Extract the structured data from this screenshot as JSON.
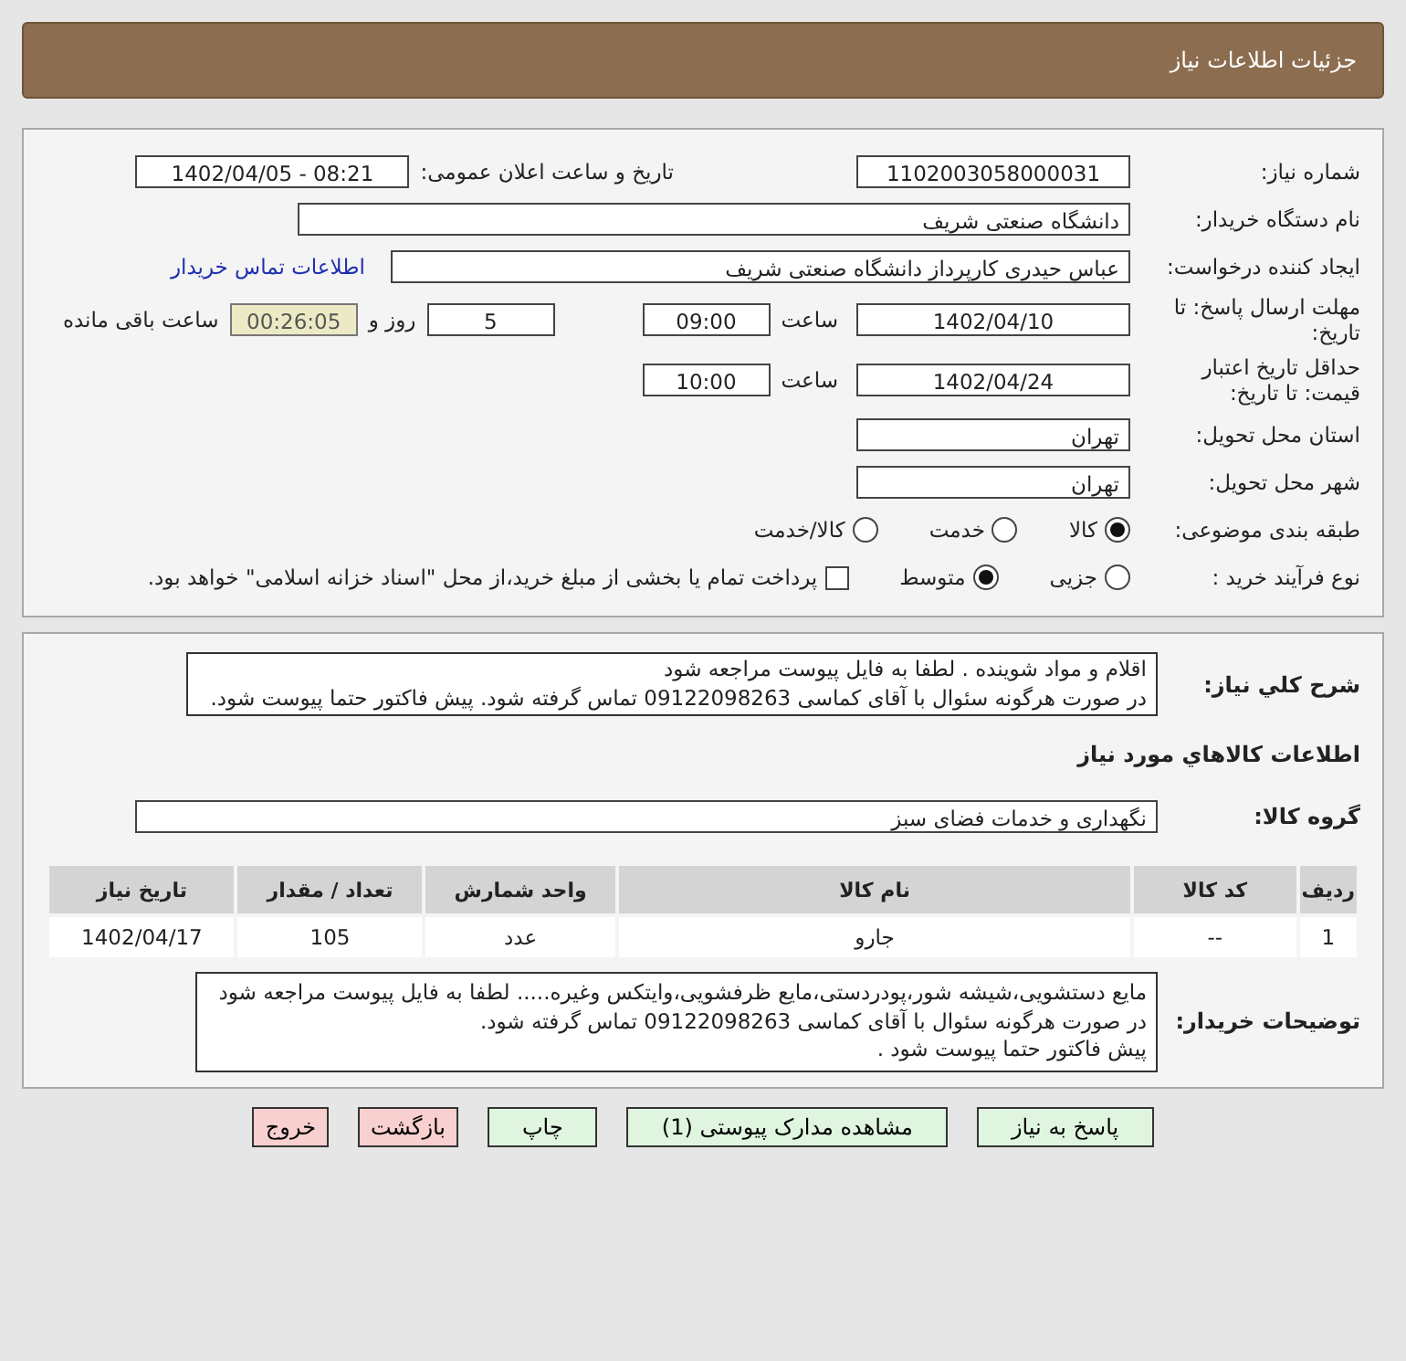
{
  "header": {
    "title": "جزئیات اطلاعات نیاز"
  },
  "need_number": {
    "label": "شماره نیاز:",
    "value": "1102003058000031"
  },
  "announce": {
    "label": "تاریخ و ساعت اعلان عمومی:",
    "value": "1402/04/05 - 08:21"
  },
  "buyer": {
    "label": "نام دستگاه خریدار:",
    "value": "دانشگاه صنعتی شریف"
  },
  "requester": {
    "label": "ایجاد کننده درخواست:",
    "value": "عباس حیدری کارپرداز دانشگاه صنعتی شریف",
    "link": "اطلاعات تماس خریدار"
  },
  "deadline": {
    "label": "مهلت ارسال پاسخ: تا تاریخ:",
    "date": "1402/04/10",
    "time_label": "ساعت",
    "time": "09:00",
    "days": "5",
    "days_label": "روز و",
    "remaining": "00:26:05",
    "remaining_label": "ساعت باقی مانده"
  },
  "validity": {
    "label": "حداقل تاریخ اعتبار قیمت: تا تاریخ:",
    "date": "1402/04/24",
    "time_label": "ساعت",
    "time": "10:00"
  },
  "province": {
    "label": "استان محل تحویل:",
    "value": "تهران"
  },
  "city": {
    "label": "شهر محل تحویل:",
    "value": "تهران"
  },
  "category": {
    "label": "طبقه بندی موضوعی:",
    "options": [
      {
        "label": "کالا",
        "selected": true
      },
      {
        "label": "خدمت",
        "selected": false
      },
      {
        "label": "کالا/خدمت",
        "selected": false
      }
    ]
  },
  "purchase_type": {
    "label": "نوع فرآیند خرید :",
    "options": [
      {
        "label": "جزیی",
        "selected": false
      },
      {
        "label": "متوسط",
        "selected": true
      }
    ],
    "payment": {
      "label": "پرداخت تمام یا بخشی از مبلغ خرید،از محل \"اسناد خزانه اسلامی\" خواهد بود.",
      "checked": false
    }
  },
  "description": {
    "label": "شرح کلي نياز:",
    "lines": [
      "اقلام و مواد شوینده . لطفا به فایل پیوست مراجعه شود",
      "در صورت هرگونه سئوال با آقای کماسی 09122098263 تماس گرفته شود. پیش فاکتور حتما پیوست شود."
    ]
  },
  "goods_title": "اطلاعات كالاهاي مورد نياز",
  "goods_group": {
    "label": "گروه کالا:",
    "value": "نگهداری و خدمات فضای سبز"
  },
  "table": {
    "columns": [
      "ردیف",
      "کد کالا",
      "نام کالا",
      "واحد شمارش",
      "تعداد / مقدار",
      "تاریخ نیاز"
    ],
    "rows": [
      [
        "1",
        "--",
        "جارو",
        "عدد",
        "105",
        "1402/04/17"
      ]
    ]
  },
  "buyer_notes": {
    "label": "توضیحات خریدار:",
    "lines": [
      "مایع دستشویی،شیشه شور،پودردستی،مایع ظرفشویی،وایتکس وغیره..... لطفا به فایل پیوست مراجعه شود",
      "در صورت هرگونه سئوال با آقای کماسی 09122098263 تماس گرفته شود.",
      "پیش فاکتور حتما پیوست شود ."
    ]
  },
  "buttons": [
    {
      "label": "پاسخ به نیاز",
      "kind": "normal"
    },
    {
      "label": "مشاهده مدارک پیوستی (1)",
      "kind": "normal"
    },
    {
      "label": "چاپ",
      "kind": "normal"
    },
    {
      "label": "بازگشت",
      "kind": "danger"
    },
    {
      "label": "خروج",
      "kind": "danger"
    }
  ]
}
